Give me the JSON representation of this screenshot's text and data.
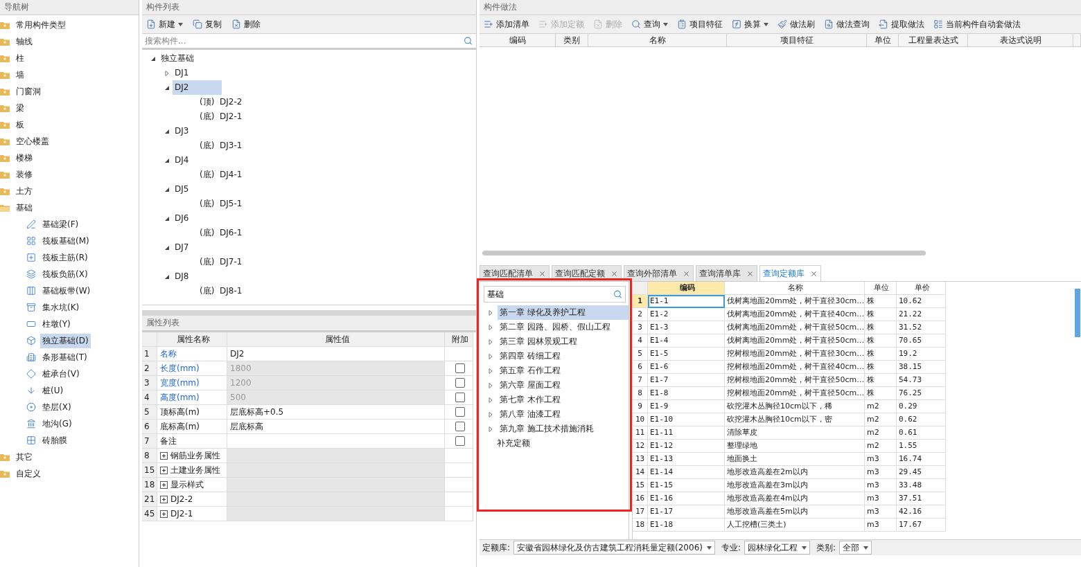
{
  "nav": {
    "title": "导航树",
    "items": [
      {
        "label": "常用构件类型",
        "expanded": false,
        "selected": false
      },
      {
        "label": "轴线",
        "expanded": false,
        "selected": false
      },
      {
        "label": "柱",
        "expanded": false,
        "selected": false
      },
      {
        "label": "墙",
        "expanded": false,
        "selected": false
      },
      {
        "label": "门窗洞",
        "expanded": false,
        "selected": false
      },
      {
        "label": "梁",
        "expanded": false,
        "selected": false
      },
      {
        "label": "板",
        "expanded": false,
        "selected": false
      },
      {
        "label": "空心楼盖",
        "expanded": false,
        "selected": false
      },
      {
        "label": "楼梯",
        "expanded": false,
        "selected": false
      },
      {
        "label": "装修",
        "expanded": false,
        "selected": false
      },
      {
        "label": "土方",
        "expanded": false,
        "selected": false
      },
      {
        "label": "基础",
        "expanded": true,
        "selected": false,
        "children": [
          {
            "label": "基础梁(F)",
            "selected": false
          },
          {
            "label": "筏板基础(M)",
            "selected": false
          },
          {
            "label": "筏板主筋(R)",
            "selected": false
          },
          {
            "label": "筏板负筋(X)",
            "selected": false
          },
          {
            "label": "基础板带(W)",
            "selected": false
          },
          {
            "label": "集水坑(K)",
            "selected": false
          },
          {
            "label": "柱墩(Y)",
            "selected": false
          },
          {
            "label": "独立基础(D)",
            "selected": true
          },
          {
            "label": "条形基础(T)",
            "selected": false
          },
          {
            "label": "桩承台(V)",
            "selected": false
          },
          {
            "label": "桩(U)",
            "selected": false
          },
          {
            "label": "垫层(X)",
            "selected": false
          },
          {
            "label": "地沟(G)",
            "selected": false
          },
          {
            "label": "砖胎膜",
            "selected": false
          }
        ]
      },
      {
        "label": "其它",
        "expanded": false,
        "selected": false
      },
      {
        "label": "自定义",
        "expanded": false,
        "selected": false
      }
    ]
  },
  "component_list": {
    "title": "构件列表",
    "toolbar": [
      {
        "label": "新建",
        "dropdown": true,
        "disabled": false
      },
      {
        "label": "复制",
        "dropdown": false,
        "disabled": false
      },
      {
        "label": "删除",
        "dropdown": false,
        "disabled": false
      }
    ],
    "search": {
      "placeholder": "搜索构件..."
    },
    "tree": [
      {
        "label": "独立基础",
        "expanded": true,
        "selected": false,
        "children": [
          {
            "label": "DJ1",
            "expanded": false,
            "selected": false
          },
          {
            "label": "DJ2",
            "expanded": true,
            "selected": true,
            "children": [
              {
                "label": "(顶)  DJ2-2",
                "selected": false
              },
              {
                "label": "(底)  DJ2-1",
                "selected": false
              }
            ]
          },
          {
            "label": "DJ3",
            "expanded": true,
            "selected": false,
            "children": [
              {
                "label": "(底)  DJ3-1",
                "selected": false
              }
            ]
          },
          {
            "label": "DJ4",
            "expanded": true,
            "selected": false,
            "children": [
              {
                "label": "(底)  DJ4-1",
                "selected": false
              }
            ]
          },
          {
            "label": "DJ5",
            "expanded": true,
            "selected": false,
            "children": [
              {
                "label": "(底)  DJ5-1",
                "selected": false
              }
            ]
          },
          {
            "label": "DJ6",
            "expanded": true,
            "selected": false,
            "children": [
              {
                "label": "(底)  DJ6-1",
                "selected": false
              }
            ]
          },
          {
            "label": "DJ7",
            "expanded": true,
            "selected": false,
            "children": [
              {
                "label": "(底)  DJ7-1",
                "selected": false
              }
            ]
          },
          {
            "label": "DJ8",
            "expanded": true,
            "selected": false,
            "children": [
              {
                "label": "(底)  DJ8-1",
                "selected": false
              }
            ]
          }
        ]
      }
    ]
  },
  "property_list": {
    "title": "属性列表",
    "columns": [
      "属性名称",
      "属性值",
      "附加"
    ],
    "rows": [
      {
        "num": "1",
        "name": "名称",
        "value": "DJ2",
        "linked": true,
        "readonly": false,
        "expandable": false
      },
      {
        "num": "2",
        "name": "长度(mm)",
        "value": "1800",
        "linked": true,
        "readonly": true,
        "expandable": false,
        "attach": {
          "checked": false
        }
      },
      {
        "num": "3",
        "name": "宽度(mm)",
        "value": "1200",
        "linked": true,
        "readonly": true,
        "expandable": false,
        "attach": {
          "checked": false
        }
      },
      {
        "num": "4",
        "name": "高度(mm)",
        "value": "500",
        "linked": true,
        "readonly": true,
        "expandable": false,
        "attach": {
          "checked": false
        }
      },
      {
        "num": "5",
        "name": "顶标高(m)",
        "value": "层底标高+0.5",
        "linked": false,
        "readonly": false,
        "expandable": false,
        "attach": {
          "checked": false
        }
      },
      {
        "num": "6",
        "name": "底标高(m)",
        "value": "层底标高",
        "linked": false,
        "readonly": false,
        "expandable": false,
        "attach": {
          "checked": false
        }
      },
      {
        "num": "7",
        "name": "备注",
        "linked": false,
        "readonly": false,
        "expandable": false,
        "attach": {
          "checked": false
        }
      },
      {
        "num": "8",
        "name": "钢筋业务属性",
        "linked": false,
        "readonly": true,
        "expandable": true
      },
      {
        "num": "15",
        "name": "土建业务属性",
        "linked": false,
        "readonly": true,
        "expandable": true
      },
      {
        "num": "18",
        "name": "显示样式",
        "linked": false,
        "readonly": true,
        "expandable": true
      },
      {
        "num": "21",
        "name": "DJ2-2",
        "linked": false,
        "readonly": true,
        "expandable": true
      },
      {
        "num": "45",
        "name": "DJ2-1",
        "linked": false,
        "readonly": true,
        "expandable": true
      }
    ]
  },
  "method_panel": {
    "title": "构件做法",
    "toolbar": [
      {
        "label": "添加清单",
        "dropdown": false,
        "disabled": false
      },
      {
        "label": "添加定额",
        "dropdown": false,
        "disabled": true
      },
      {
        "label": "删除",
        "dropdown": false,
        "disabled": true
      },
      {
        "label": "查询",
        "dropdown": true,
        "disabled": false
      },
      {
        "label": "项目特征",
        "dropdown": false,
        "disabled": false
      },
      {
        "label": "换算",
        "dropdown": true,
        "disabled": false
      },
      {
        "label": "做法刷",
        "dropdown": false,
        "disabled": false
      },
      {
        "label": "做法查询",
        "dropdown": false,
        "disabled": false
      },
      {
        "label": "提取做法",
        "dropdown": false,
        "disabled": false
      },
      {
        "label": "当前构件自动套做法",
        "dropdown": false,
        "disabled": false
      }
    ],
    "columns": [
      "编码",
      "类别",
      "名称",
      "项目特征",
      "单位",
      "工程量表达式",
      "表达式说明"
    ]
  },
  "query_tabs": [
    {
      "label": "查询匹配清单",
      "selected": false
    },
    {
      "label": "查询匹配定额",
      "selected": false
    },
    {
      "label": "查询外部清单",
      "selected": false
    },
    {
      "label": "查询清单库",
      "selected": false
    },
    {
      "label": "查询定额库",
      "selected": true
    }
  ],
  "quota_library": {
    "search": {
      "value": "基础"
    },
    "chapters": [
      {
        "label": "第一章 绿化及养护工程",
        "expandable": true,
        "selected": true
      },
      {
        "label": "第二章 园路、园桥、假山工程",
        "expandable": true,
        "selected": false
      },
      {
        "label": "第三章 园林景观工程",
        "expandable": true,
        "selected": false
      },
      {
        "label": "第四章 砖细工程",
        "expandable": true,
        "selected": false
      },
      {
        "label": "第五章 石作工程",
        "expandable": true,
        "selected": false
      },
      {
        "label": "第六章 屋面工程",
        "expandable": true,
        "selected": false
      },
      {
        "label": "第七章 木作工程",
        "expandable": true,
        "selected": false
      },
      {
        "label": "第八章 油漆工程",
        "expandable": true,
        "selected": false
      },
      {
        "label": "第九章 施工技术措施消耗",
        "expandable": true,
        "selected": false
      },
      {
        "label": "补充定额",
        "expandable": false,
        "selected": false
      }
    ],
    "columns": [
      "编码",
      "名称",
      "单位",
      "单价"
    ],
    "rows": [
      {
        "num": "1",
        "code": "E1-1",
        "name": "伐树离地面20mm处，树干直径30cm…",
        "unit": "株",
        "price": "10.62",
        "selected": true
      },
      {
        "num": "2",
        "code": "E1-2",
        "name": "伐树离地面20mm处，树干直径40cm…",
        "unit": "株",
        "price": "21.22",
        "selected": false
      },
      {
        "num": "3",
        "code": "E1-3",
        "name": "伐树离地面20mm处，树干直径50cm…",
        "unit": "株",
        "price": "31.52",
        "selected": false
      },
      {
        "num": "4",
        "code": "E1-4",
        "name": "伐树离地面20mm处，树干直径50cm…",
        "unit": "株",
        "price": "70.65",
        "selected": false
      },
      {
        "num": "5",
        "code": "E1-5",
        "name": "挖树根地面20mm处，树干直径30cm…",
        "unit": "株",
        "price": "19.2",
        "selected": false
      },
      {
        "num": "6",
        "code": "E1-6",
        "name": "挖树根地面20mm处，树干直径40cm…",
        "unit": "株",
        "price": "38.15",
        "selected": false
      },
      {
        "num": "7",
        "code": "E1-7",
        "name": "挖树根地面20mm处，树干直径50cm…",
        "unit": "株",
        "price": "54.73",
        "selected": false
      },
      {
        "num": "8",
        "code": "E1-8",
        "name": "挖树根地面20mm处，树干直径50cm…",
        "unit": "株",
        "price": "76.25",
        "selected": false
      },
      {
        "num": "9",
        "code": "E1-9",
        "name": "砍挖灌木丛胸径10cm以下，稀",
        "unit": "m2",
        "price": "0.29",
        "selected": false
      },
      {
        "num": "10",
        "code": "E1-10",
        "name": "砍挖灌木丛胸径10cm以下，密",
        "unit": "m2",
        "price": "0.62",
        "selected": false
      },
      {
        "num": "11",
        "code": "E1-11",
        "name": "清除草皮",
        "unit": "m2",
        "price": "0.61",
        "selected": false
      },
      {
        "num": "12",
        "code": "E1-12",
        "name": "整理绿地",
        "unit": "m2",
        "price": "1.55",
        "selected": false
      },
      {
        "num": "13",
        "code": "E1-13",
        "name": "地面换土",
        "unit": "m3",
        "price": "16.74",
        "selected": false
      },
      {
        "num": "14",
        "code": "E1-14",
        "name": "地形改造高差在2m以内",
        "unit": "m3",
        "price": "29.45",
        "selected": false
      },
      {
        "num": "15",
        "code": "E1-15",
        "name": "地形改造高差在3m以内",
        "unit": "m3",
        "price": "33.48",
        "selected": false
      },
      {
        "num": "16",
        "code": "E1-16",
        "name": "地形改造高差在4m以内",
        "unit": "m3",
        "price": "37.51",
        "selected": false
      },
      {
        "num": "17",
        "code": "E1-17",
        "name": "地形改造高差在5m以内",
        "unit": "m3",
        "price": "42.16",
        "selected": false
      },
      {
        "num": "18",
        "code": "E1-18",
        "name": "人工挖槽(三类土)",
        "unit": "m3",
        "price": "17.67",
        "selected": false
      }
    ],
    "filters": [
      {
        "label": "定额库:",
        "value": "安徽省园林绿化及仿古建筑工程消耗量定额(2006)"
      },
      {
        "label": "专业:",
        "value": "园林绿化工程"
      },
      {
        "label": "类别:",
        "value": "全部"
      }
    ]
  }
}
